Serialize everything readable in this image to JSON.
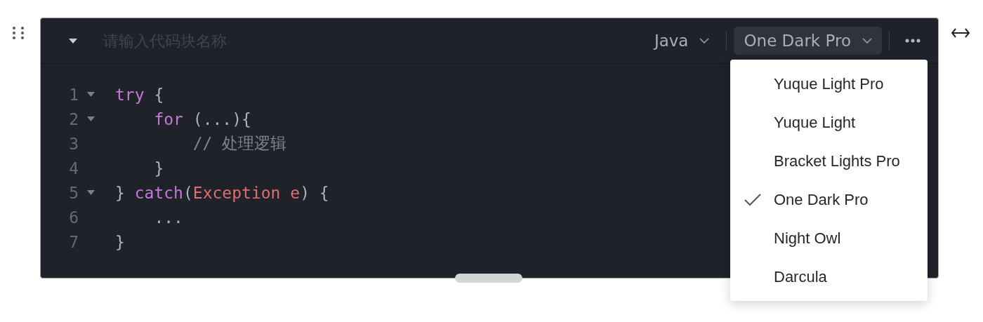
{
  "code_block": {
    "name_field": {
      "placeholder": "请输入代码块名称"
    },
    "language": "Java",
    "theme": "One Dark Pro",
    "theme_menu_expanded": true,
    "lines": [
      {
        "number": "1",
        "foldable": true,
        "tokens": [
          {
            "kind": "keyword",
            "text": "try"
          },
          {
            "kind": "plain",
            "text": " {"
          }
        ]
      },
      {
        "number": "2",
        "foldable": true,
        "tokens": [
          {
            "kind": "keyword",
            "text": "    for"
          },
          {
            "kind": "plain",
            "text": " (...){"
          }
        ]
      },
      {
        "number": "3",
        "foldable": false,
        "tokens": [
          {
            "kind": "comment",
            "text": "        // 处理逻辑"
          }
        ]
      },
      {
        "number": "4",
        "foldable": false,
        "tokens": [
          {
            "kind": "plain",
            "text": "    }"
          }
        ]
      },
      {
        "number": "5",
        "foldable": true,
        "tokens": [
          {
            "kind": "plain",
            "text": "} "
          },
          {
            "kind": "keyword",
            "text": "catch"
          },
          {
            "kind": "plain",
            "text": "("
          },
          {
            "kind": "type",
            "text": "Exception e"
          },
          {
            "kind": "plain",
            "text": ") {"
          }
        ]
      },
      {
        "number": "6",
        "foldable": false,
        "tokens": [
          {
            "kind": "plain",
            "text": "    ..."
          }
        ]
      },
      {
        "number": "7",
        "foldable": false,
        "tokens": [
          {
            "kind": "plain",
            "text": "}"
          }
        ]
      }
    ]
  },
  "theme_menu": [
    {
      "label": "Yuque Light Pro",
      "selected": false
    },
    {
      "label": "Yuque Light",
      "selected": false
    },
    {
      "label": "Bracket Lights Pro",
      "selected": false
    },
    {
      "label": "One Dark Pro",
      "selected": true
    },
    {
      "label": "Night Owl",
      "selected": false
    },
    {
      "label": "Darcula",
      "selected": false
    }
  ]
}
